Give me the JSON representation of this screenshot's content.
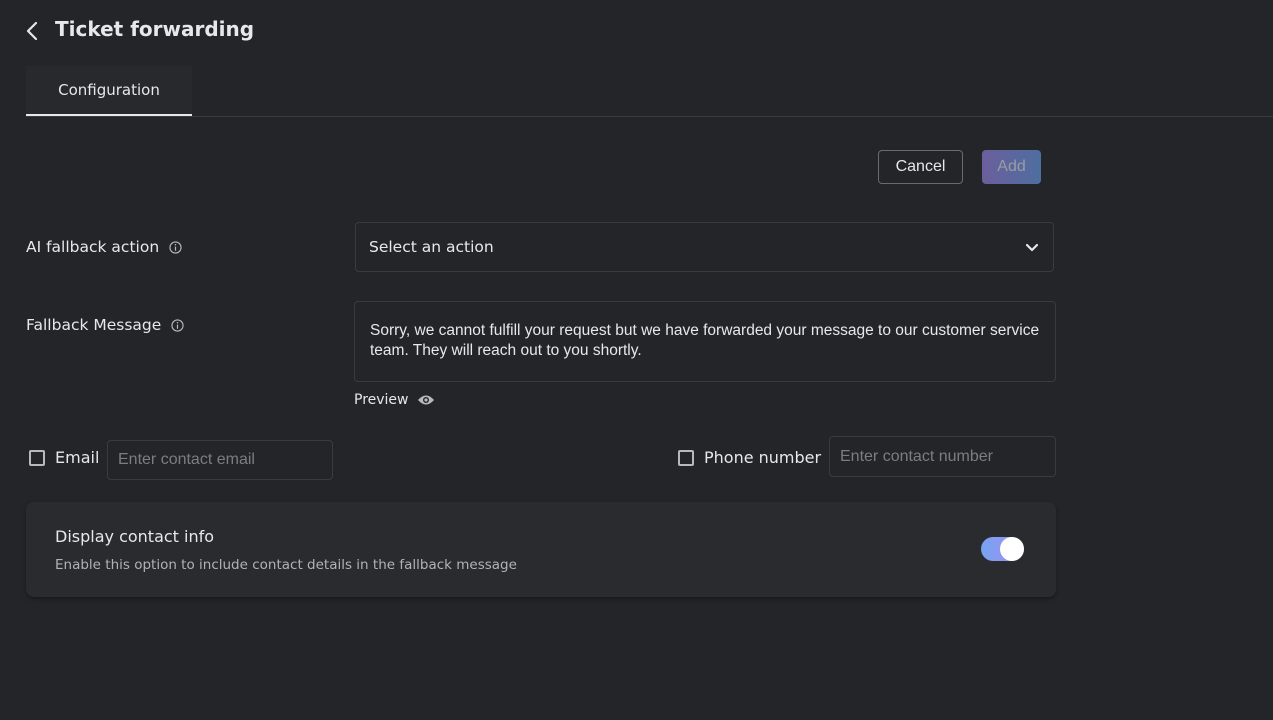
{
  "header": {
    "title": "Ticket forwarding",
    "back_icon": "chevron-left-icon"
  },
  "tabs": [
    {
      "label": "Configuration",
      "active": true
    }
  ],
  "toolbar": {
    "cancel_label": "Cancel",
    "add_label": "Add",
    "add_disabled": true
  },
  "form": {
    "ai_fallback_action": {
      "label": "AI fallback action",
      "value": "Select an action"
    },
    "fallback_message": {
      "label": "Fallback Message",
      "value": "Sorry, we cannot fulfill your request but we have forwarded your message to our customer service team. They will reach out to you shortly.",
      "preview_label": "Preview"
    },
    "email": {
      "label": "Email",
      "checked": false,
      "placeholder": "Enter contact email",
      "value": ""
    },
    "phone": {
      "label": "Phone number",
      "checked": false,
      "placeholder": "Enter contact number",
      "value": ""
    },
    "display_contact": {
      "title": "Display contact info",
      "description": "Enable this option to include contact details in the fallback message",
      "enabled": true
    }
  },
  "colors": {
    "background": "#242528",
    "toggle_start": "#76a3f0",
    "toggle_end": "#a48ef2",
    "add_start": "#6a5f9c",
    "add_end": "#4f6ea0"
  }
}
